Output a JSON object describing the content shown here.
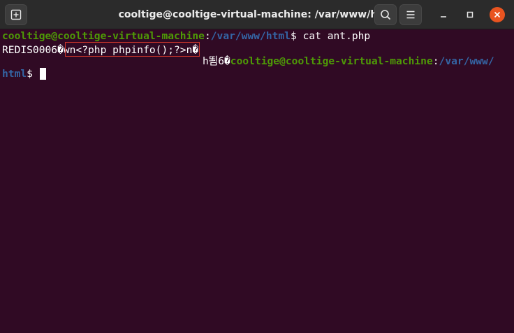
{
  "window": {
    "title": "cooltige@cooltige-virtual-machine: /var/www/html"
  },
  "titlebar": {
    "buttons": {
      "new_tab": "new-tab-icon",
      "search": "search-icon",
      "menu": "hamburger-menu-icon",
      "minimize": "minimize-icon",
      "maximize": "maximize-icon",
      "close": "close-icon"
    },
    "close_color": "#e95420"
  },
  "colors": {
    "background": "#300a24",
    "prompt_user": "#4e9a06",
    "prompt_path": "#3465a4",
    "highlight_box": "#d0372c"
  },
  "terminal": {
    "line1": {
      "user_host": "cooltige@cooltige-virtual-machine",
      "colon": ":",
      "path": "/var/www/html",
      "dollar": "$ ",
      "command": "cat ant.php"
    },
    "line2": {
      "prefix": "REDIS0006�",
      "highlighted": "wn<?php phpinfo();?>n�"
    },
    "line3": {
      "garbage": "h뙴6�",
      "user_host": "cooltige@cooltige-virtual-machine",
      "colon": ":",
      "path": "/var/www/"
    },
    "line4": {
      "path": "html",
      "dollar": "$ "
    }
  }
}
